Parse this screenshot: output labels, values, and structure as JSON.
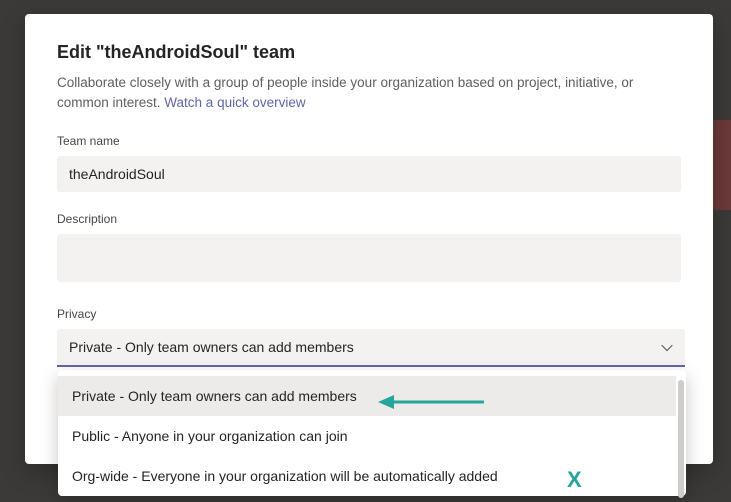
{
  "modal": {
    "title": "Edit \"theAndroidSoul\" team",
    "subtitle_prefix": "Collaborate closely with a group of people inside your organization based on project, initiative, or common interest. ",
    "subtitle_link": "Watch a quick overview"
  },
  "form": {
    "team_name_label": "Team name",
    "team_name_value": "theAndroidSoul",
    "description_label": "Description",
    "description_value": "",
    "privacy_label": "Privacy",
    "privacy_value": "Private - Only team owners can add members"
  },
  "dropdown": {
    "option_private": "Private - Only team owners can add members",
    "option_public": "Public - Anyone in your organization can join",
    "option_orgwide": "Org-wide - Everyone in your organization will be automatically added"
  },
  "annotations": {
    "x_mark": "X"
  }
}
